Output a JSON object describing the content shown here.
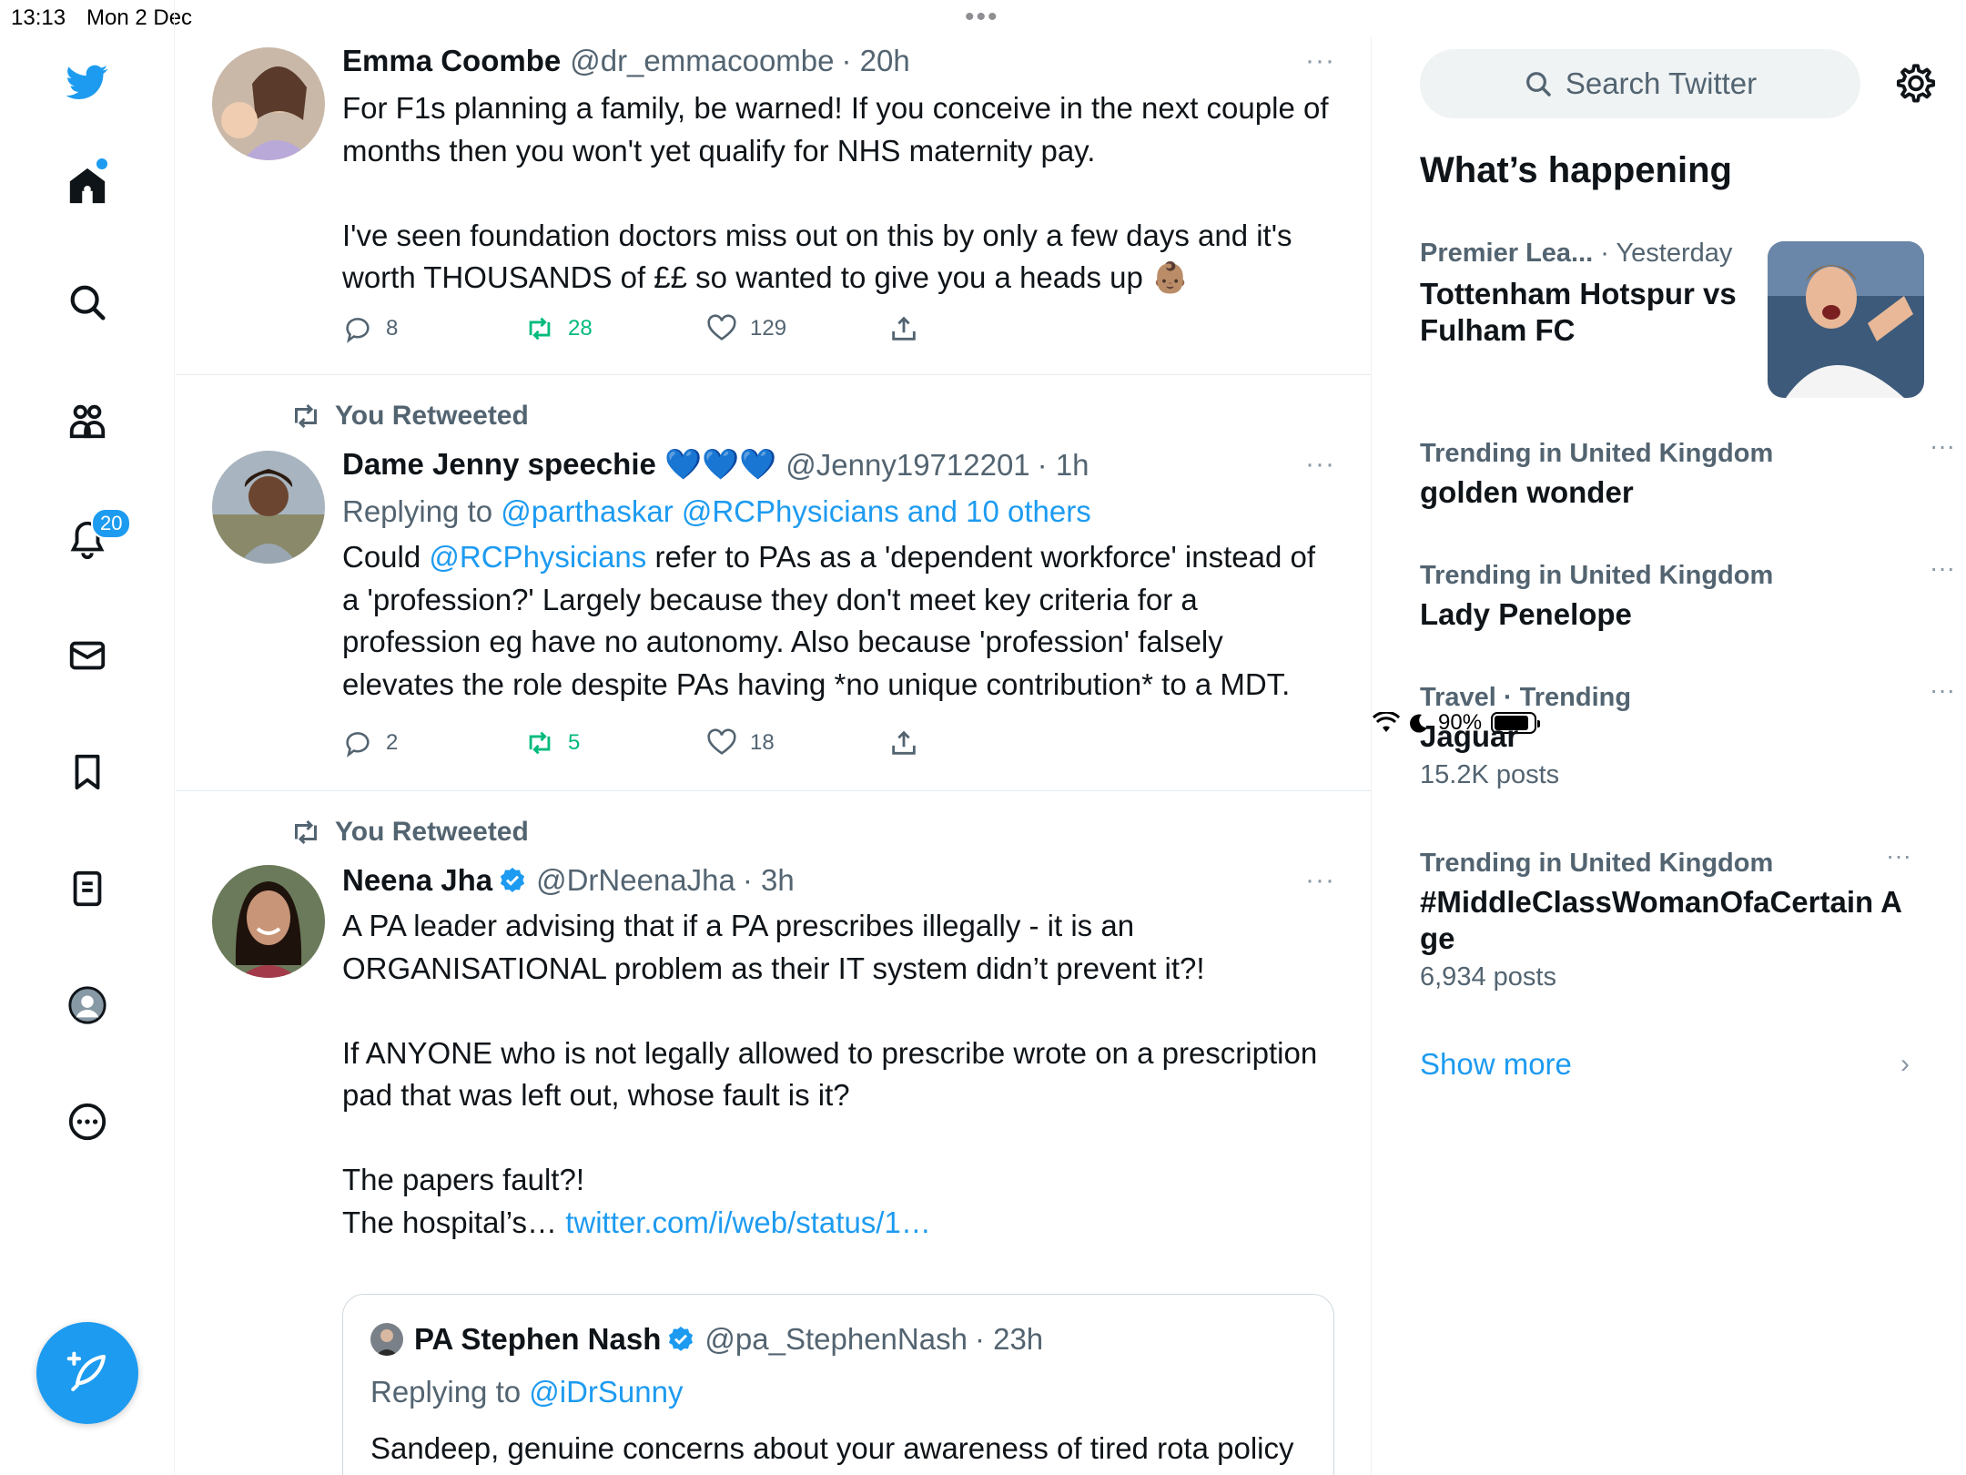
{
  "status_bar": {
    "time": "13:13",
    "date": "Mon 2 Dec",
    "battery": "90%",
    "multitask_dots": "•••"
  },
  "nav": {
    "notifications_badge": "20",
    "colors": {
      "accent": "#1d9bf0",
      "retweet": "#00ba7c"
    }
  },
  "tweets": [
    {
      "name": "Emma Coombe",
      "handle": "@dr_emmacoombe",
      "time": "· 20h",
      "more": "···",
      "text": "For F1s planning a family, be warned! If you conceive in the next couple of months then you won't yet qualify for NHS maternity pay.\n\nI've seen foundation doctors miss out on this by only a few days and it's worth THOUSANDS of ££ so wanted to give you a heads up 👶🏽",
      "replies": "8",
      "retweets": "28",
      "likes": "129"
    },
    {
      "retweeted_label": "You Retweeted",
      "name": "Dame Jenny speechie 💙💙💙",
      "handle": "@Jenny19712201",
      "time": "· 1h",
      "more": "···",
      "replying_prefix": "Replying to ",
      "replying_to": "@parthaskar @RCPhysicians and 10 others",
      "text_prefix": "Could ",
      "text_mention": "@RCPhysicians",
      "text_rest": " refer to PAs as a 'dependent workforce' instead of a 'profession?' Largely because they don't meet key criteria for a profession eg have no autonomy. Also because 'profession' falsely elevates the role despite PAs having *no unique contribution* to a MDT.",
      "replies": "2",
      "retweets": "5",
      "likes": "18"
    },
    {
      "retweeted_label": "You Retweeted",
      "name": "Neena Jha",
      "handle": "@DrNeenaJha",
      "time": "· 3h",
      "more": "···",
      "text": "A PA leader advising that if a PA prescribes illegally - it is an ORGANISATIONAL problem as their IT system didn’t prevent it?!\n\nIf ANYONE who is not legally allowed to prescribe wrote on a prescription pad that was left out, whose fault is it?\n\nThe papers fault?!\nThe hospital’s… ",
      "text_link": "twitter.com/i/web/status/1…",
      "quote": {
        "name": "PA Stephen Nash",
        "handle": "@pa_StephenNash",
        "time": "· 23h",
        "replying_prefix": "Replying to ",
        "replying_to": "@iDrSunny",
        "text": "Sandeep, genuine concerns about your awareness of tired rota policy in the UK. You should perhaps learn more about safe"
      }
    }
  ],
  "sidebar": {
    "search_placeholder": "Search Twitter",
    "heading": "What’s happening",
    "trends": [
      {
        "context": "Premier Lea...",
        "context_suffix": " · Yesterday",
        "name": "Tottenham Hotspur vs Fulham FC"
      },
      {
        "context": "Trending in United Kingdom",
        "name": "golden wonder",
        "more": "···"
      },
      {
        "context": "Trending in United Kingdom",
        "name": "Lady Penelope",
        "more": "···"
      },
      {
        "context": "Travel · Trending",
        "name": "Jaguar",
        "count": "15.2K posts",
        "more": "···"
      },
      {
        "context": "Trending in United Kingdom",
        "name": "#MiddleClassWomanOfaCertain Age",
        "count": "6,934 posts",
        "more": "···"
      }
    ],
    "show_more": "Show more",
    "chevron": "›"
  }
}
